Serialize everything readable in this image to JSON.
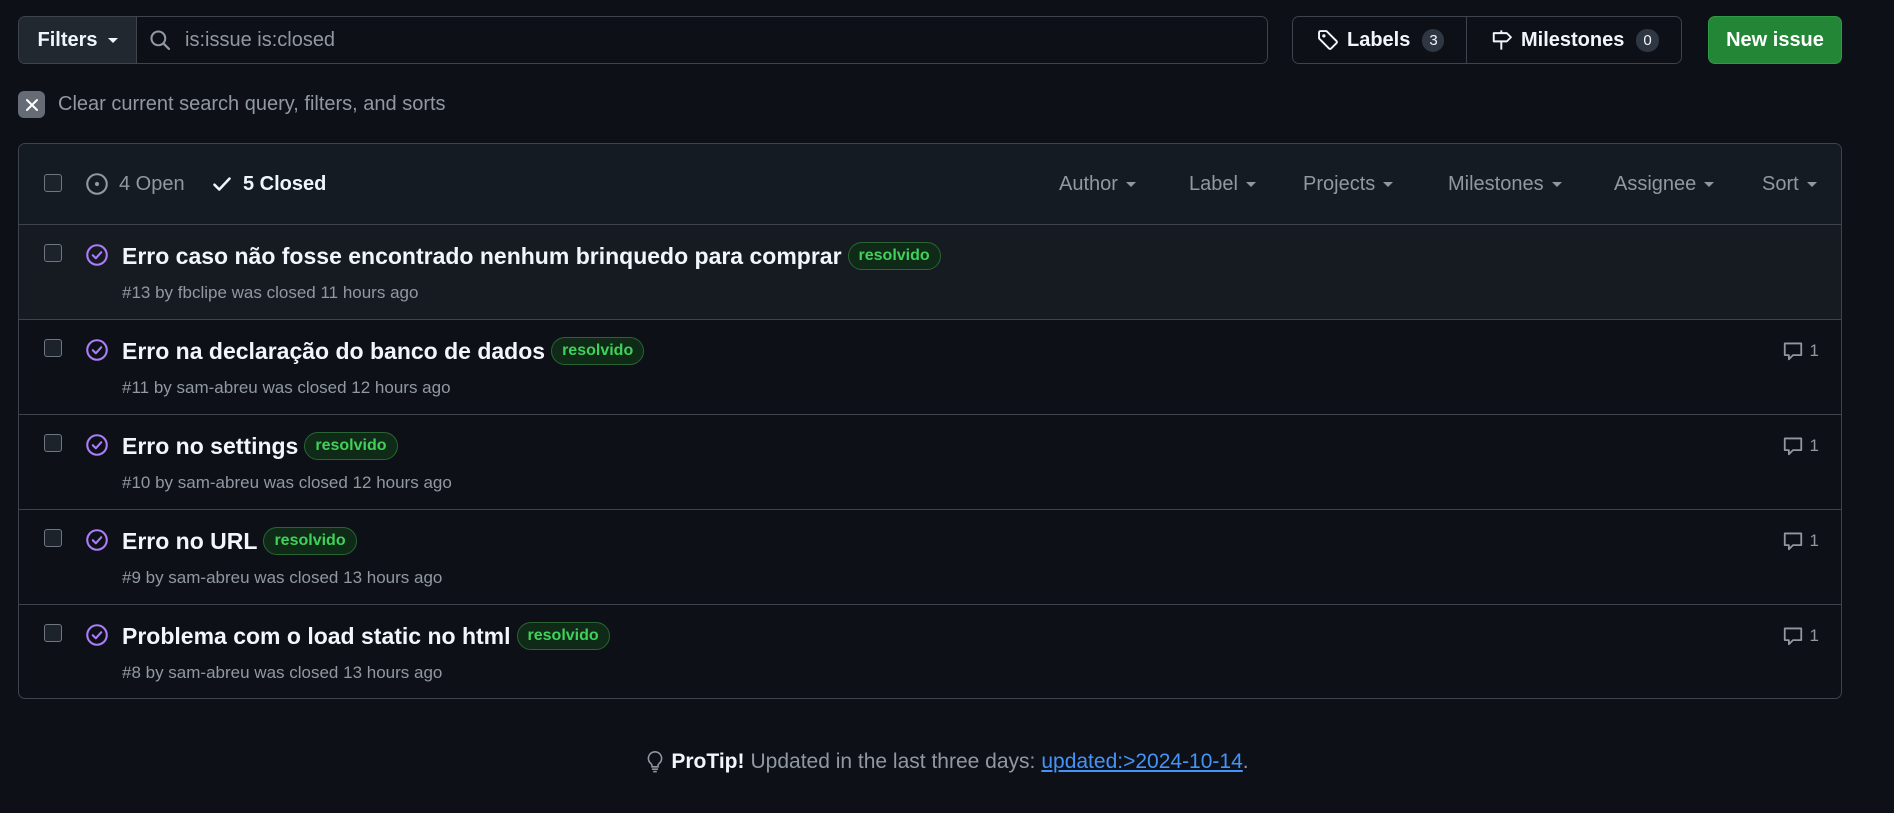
{
  "toolbar": {
    "filters_label": "Filters",
    "search_value": "is:issue is:closed",
    "labels_label": "Labels",
    "labels_count": "3",
    "milestones_label": "Milestones",
    "milestones_count": "0",
    "new_issue_label": "New issue"
  },
  "clear_query": {
    "text": "Clear current search query, filters, and sorts"
  },
  "list_header": {
    "open_label": "4 Open",
    "closed_label": "5 Closed",
    "menus": [
      "Author",
      "Label",
      "Projects",
      "Milestones",
      "Assignee",
      "Sort"
    ]
  },
  "issues": [
    {
      "title": "Erro caso não fosse encontrado nenhum brinquedo para comprar",
      "label": "resolvido",
      "meta": "#13 by fbclipe was closed 11 hours ago",
      "comments": ""
    },
    {
      "title": "Erro na declaração do banco de dados",
      "label": "resolvido",
      "meta": "#11 by sam-abreu was closed 12 hours ago",
      "comments": "1"
    },
    {
      "title": "Erro no settings",
      "label": "resolvido",
      "meta": "#10 by sam-abreu was closed 12 hours ago",
      "comments": "1"
    },
    {
      "title": "Erro no URL",
      "label": "resolvido",
      "meta": "#9 by sam-abreu was closed 13 hours ago",
      "comments": "1"
    },
    {
      "title": "Problema com o load static no html",
      "label": "resolvido",
      "meta": "#8 by sam-abreu was closed 13 hours ago",
      "comments": "1"
    }
  ],
  "protip": {
    "heading": "ProTip!",
    "text": "Updated in the last three days:",
    "link": "updated:>2024-10-14",
    "suffix": "."
  },
  "colors": {
    "background": "#0d1117",
    "accent_green": "#238636",
    "closed_purple": "#ab7df8",
    "label_green": "#3fd15a",
    "link_blue": "#4493f8"
  },
  "icons": {
    "search": "search-icon",
    "tag": "tag-icon",
    "milestone": "milestone-icon",
    "close": "x-icon",
    "issue_open": "issue-opened-icon",
    "check": "check-icon",
    "issue_closed": "issue-closed-icon",
    "comment": "comment-icon",
    "light_bulb": "light-bulb-icon"
  }
}
